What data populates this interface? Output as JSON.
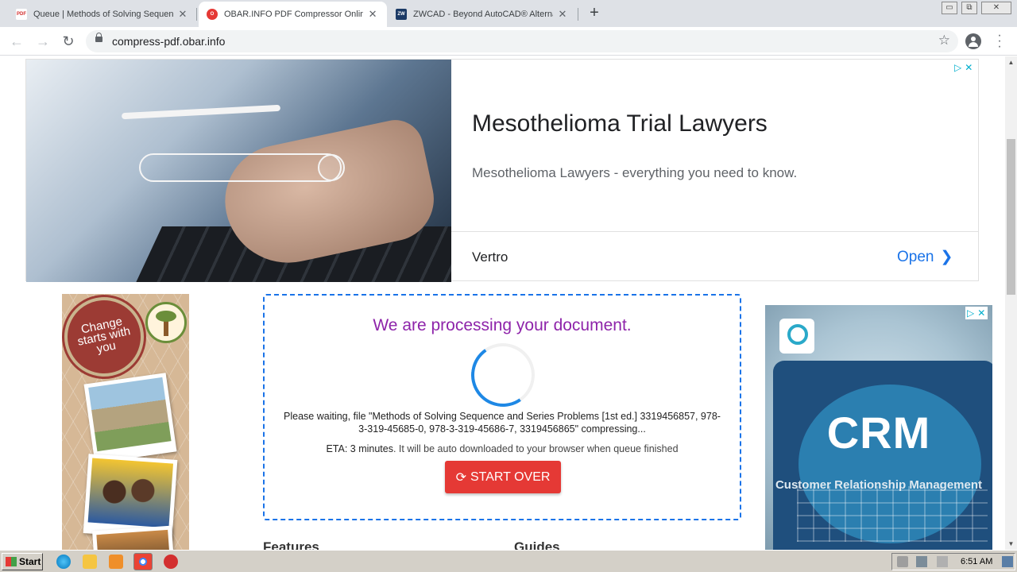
{
  "browser": {
    "tabs": [
      {
        "title": "Queue | Methods of Solving Sequenc",
        "favicon": "pdf-favicon-icon",
        "active": false
      },
      {
        "title": "OBAR.INFO PDF Compressor Online",
        "favicon": "obar-favicon-icon",
        "active": true
      },
      {
        "title": "ZWCAD - Beyond AutoCAD® Alterna",
        "favicon": "zwcad-favicon-icon",
        "active": false
      }
    ],
    "new_tab": "+",
    "url": "compress-pdf.obar.info",
    "window_controls": {
      "minimize": "▭",
      "restore": "⧉",
      "close": "✕"
    }
  },
  "top_ad": {
    "headline": "Mesothelioma Trial Lawyers",
    "description": "Mesothelioma Lawyers - everything you need to know.",
    "advertiser": "Vertro",
    "cta": "Open",
    "cta_chevron": "❯"
  },
  "left_banner": {
    "seal_text": "Change starts with you"
  },
  "processing": {
    "title": "We are processing your document.",
    "message": "Please waiting, file \"Methods of Solving Sequence and Series Problems [1st ed.] 3319456857, 978-3-319-45685-0, 978-3-319-45686-7, 3319456865\" compressing...",
    "eta_label": "ETA: 3 minutes",
    "eta_text": ". It will be auto downloaded to your browser when queue finished",
    "button_label": "START OVER",
    "button_icon": "⟳"
  },
  "sections": {
    "features": "Features",
    "guides": "Guides"
  },
  "right_ad": {
    "headline": "CRM",
    "subline": "Customer Relationship Management"
  },
  "taskbar": {
    "start_label": "Start",
    "clock": "6:51 AM"
  },
  "colors": {
    "title_purple": "#8e24aa",
    "button_red": "#e53935",
    "link_blue": "#1a73e8",
    "dashed_border": "#1a73e8"
  }
}
